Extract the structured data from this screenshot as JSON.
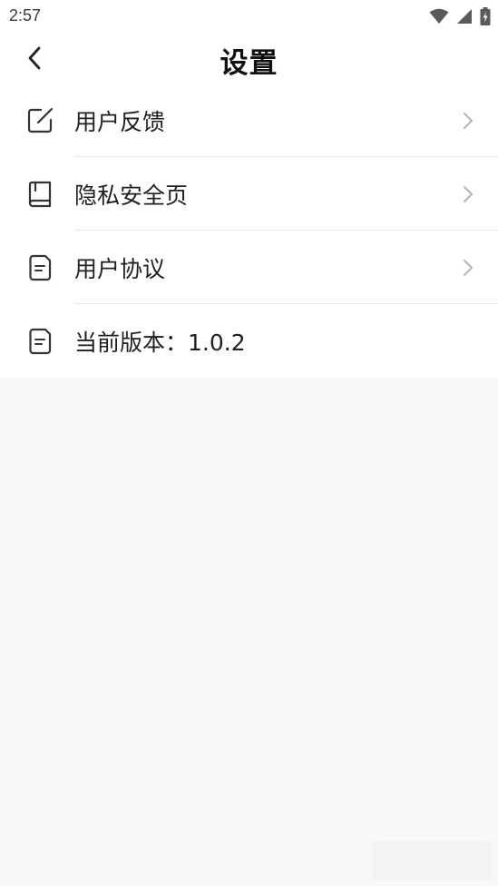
{
  "status_bar": {
    "time": "2:57"
  },
  "header": {
    "title": "设置"
  },
  "menu": {
    "items": [
      {
        "label": "用户反馈",
        "icon": "edit-icon",
        "has_chevron": true
      },
      {
        "label": "隐私安全页",
        "icon": "book-icon",
        "has_chevron": true
      },
      {
        "label": "用户协议",
        "icon": "document-icon",
        "has_chevron": true
      },
      {
        "label": "当前版本：1.0.2",
        "icon": "document-icon",
        "has_chevron": false
      }
    ]
  },
  "colors": {
    "background": "#f7f8fa",
    "surface": "#ffffff",
    "text": "#1f1f1f",
    "divider": "#e8e8e8",
    "chevron": "#b5b5b5"
  }
}
